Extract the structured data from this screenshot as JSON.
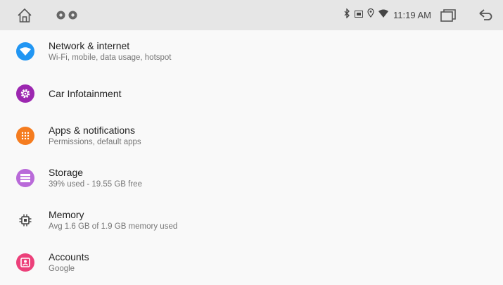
{
  "status_bar": {
    "time": "11:19 AM",
    "icons": [
      "bluetooth-icon",
      "sim-icon",
      "location-icon",
      "wifi-icon"
    ],
    "notifications": [
      "notification-icon",
      "notification-icon"
    ]
  },
  "settings": {
    "items": [
      {
        "title": "Network & internet",
        "subtitle": "Wi-Fi, mobile, data usage, hotspot",
        "icon": "wifi-icon",
        "color": "#2196f3"
      },
      {
        "title": "Car Infotainment",
        "subtitle": "",
        "icon": "gear-icon",
        "color": "#9c27b0"
      },
      {
        "title": "Apps & notifications",
        "subtitle": "Permissions, default apps",
        "icon": "apps-grid-icon",
        "color": "#f57c1f"
      },
      {
        "title": "Storage",
        "subtitle": "39% used - 19.55 GB free",
        "icon": "storage-icon",
        "color": "#b96ad9"
      },
      {
        "title": "Memory",
        "subtitle": "Avg 1.6 GB of 1.9 GB memory used",
        "icon": "memory-chip-icon",
        "color": "#555555"
      },
      {
        "title": "Accounts",
        "subtitle": "Google",
        "icon": "account-icon",
        "color": "#ec407a"
      }
    ]
  }
}
